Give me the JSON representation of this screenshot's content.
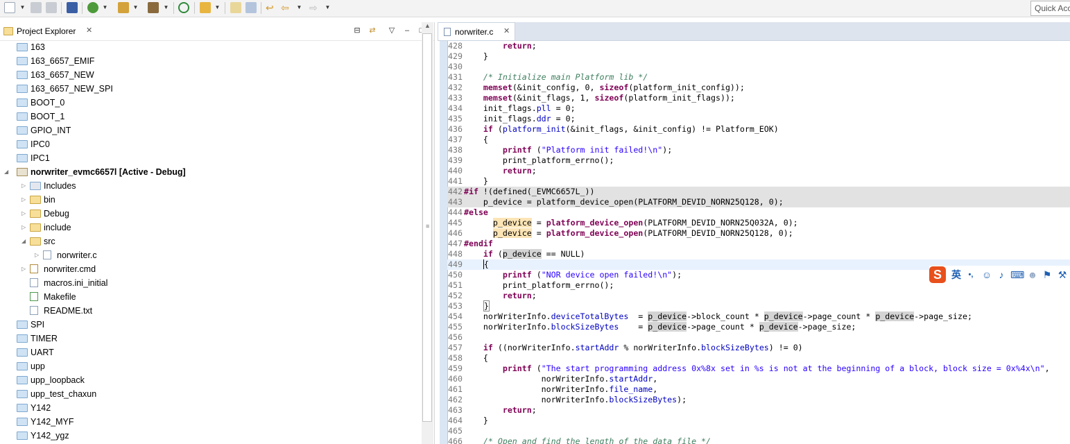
{
  "toolbar": {
    "quick_access_placeholder": "Quick Acc"
  },
  "project_explorer": {
    "title": "Project Explorer",
    "close_glyph": "✕",
    "collapse_all_glyph": "⊟",
    "link_glyph": "⇄",
    "view_menu_glyph": "▽",
    "minimize_glyph": "–",
    "maximize_glyph": "□",
    "items": [
      {
        "label": "163",
        "icon": "folder-icon"
      },
      {
        "label": "163_6657_EMIF",
        "icon": "folder-icon"
      },
      {
        "label": "163_6657_NEW",
        "icon": "folder-icon"
      },
      {
        "label": "163_6657_NEW_SPI",
        "icon": "folder-icon"
      },
      {
        "label": "BOOT_0",
        "icon": "folder-icon"
      },
      {
        "label": "BOOT_1",
        "icon": "folder-icon"
      },
      {
        "label": "GPIO_INT",
        "icon": "folder-icon"
      },
      {
        "label": "IPC0",
        "icon": "folder-icon"
      },
      {
        "label": "IPC1",
        "icon": "folder-icon"
      },
      {
        "label": "norwriter_evmc6657l  [Active - Debug]",
        "icon": "ccs-project-icon",
        "expanded": true
      },
      {
        "label": "Includes",
        "icon": "includes-icon"
      },
      {
        "label": "bin",
        "icon": "folder-icon"
      },
      {
        "label": "Debug",
        "icon": "folder-icon"
      },
      {
        "label": "include",
        "icon": "folder-icon"
      },
      {
        "label": "src",
        "icon": "folder-icon",
        "expanded": true
      },
      {
        "label": "norwriter.c",
        "icon": "c-file-icon"
      },
      {
        "label": "norwriter.cmd",
        "icon": "cmd-file-icon"
      },
      {
        "label": "macros.ini_initial",
        "icon": "file-icon"
      },
      {
        "label": "Makefile",
        "icon": "makefile-icon"
      },
      {
        "label": "README.txt",
        "icon": "text-file-icon"
      },
      {
        "label": "SPI",
        "icon": "folder-icon"
      },
      {
        "label": "TIMER",
        "icon": "folder-icon"
      },
      {
        "label": "UART",
        "icon": "folder-icon"
      },
      {
        "label": "upp",
        "icon": "folder-icon"
      },
      {
        "label": "upp_loopback",
        "icon": "folder-icon"
      },
      {
        "label": "upp_test_chaxun",
        "icon": "folder-icon"
      },
      {
        "label": "Y142",
        "icon": "folder-icon"
      },
      {
        "label": "Y142_MYF",
        "icon": "folder-icon"
      },
      {
        "label": "Y142_ygz",
        "icon": "folder-icon"
      }
    ]
  },
  "editor": {
    "tab_label": "norwriter.c",
    "tab_close_glyph": "✕",
    "line_numbers": [
      "428",
      "429",
      "430",
      "431",
      "432",
      "433",
      "434",
      "435",
      "436",
      "437",
      "438",
      "439",
      "440",
      "441",
      "442",
      "443",
      "444",
      "445",
      "446",
      "447",
      "448",
      "449",
      "450",
      "451",
      "452",
      "453",
      "454",
      "455",
      "456",
      "457",
      "458",
      "459",
      "460",
      "461",
      "462",
      "463",
      "464",
      "465",
      "466"
    ]
  },
  "ime": {
    "logo": "S",
    "mode": "英",
    "punct": "•,",
    "emoji_glyph": "☺",
    "mic_glyph": "♪",
    "keyboard_glyph": "⌨",
    "user_glyph": "☻",
    "skin_glyph": "⚑",
    "tools_glyph": "⚒"
  },
  "colors": {
    "keyword": "#7f0055",
    "comment": "#3f7f5f",
    "string": "#2a00ff",
    "field": "#0000c0",
    "inactive_code_bg": "#e2e2e2",
    "highlight_bg": "#fbe4b5",
    "ime_logo": "#e8501c"
  }
}
